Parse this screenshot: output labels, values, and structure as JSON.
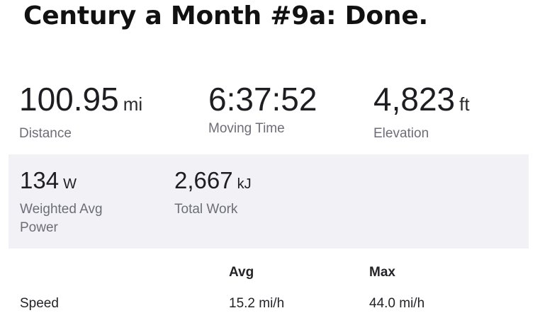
{
  "activity": {
    "title": "Century a Month #9a: Done."
  },
  "primary_stats": {
    "distance": {
      "value": "100.95",
      "unit": "mi",
      "label": "Distance"
    },
    "moving_time": {
      "value": "6:37:52",
      "label": "Moving Time"
    },
    "elevation": {
      "value": "4,823",
      "unit": "ft",
      "label": "Elevation"
    }
  },
  "secondary_stats": {
    "weighted_avg_power": {
      "value": "134",
      "unit": "W",
      "label": "Weighted Avg Power"
    },
    "total_work": {
      "value": "2,667",
      "unit": "kJ",
      "label": "Total Work"
    }
  },
  "table": {
    "headers": {
      "avg": "Avg",
      "max": "Max"
    },
    "rows": [
      {
        "label": "Speed",
        "avg": "15.2 mi/h",
        "max": "44.0 mi/h"
      }
    ]
  },
  "colors": {
    "panel_background": "#f2f2f6",
    "label_gray": "#6d6d78",
    "text_dark": "#242428"
  }
}
